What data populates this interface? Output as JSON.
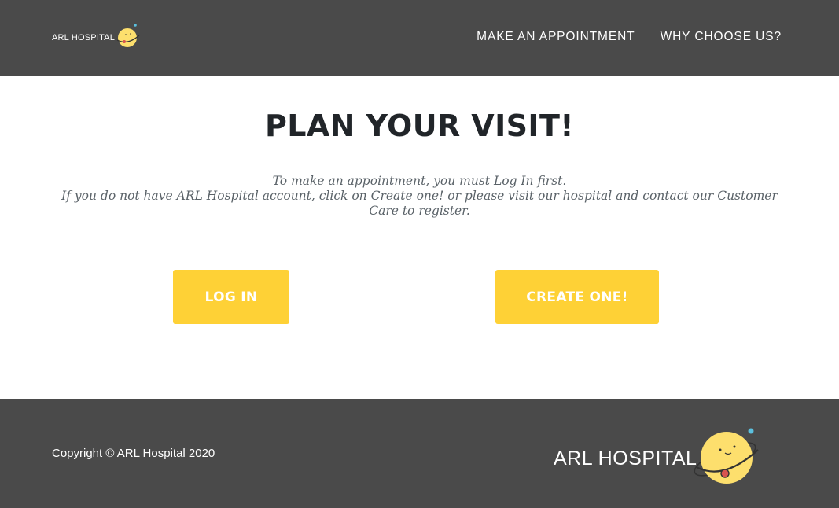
{
  "header": {
    "brand_text": "ARL HOSPITAL",
    "logo_icon": "planet-smiley-icon",
    "nav": [
      {
        "label": "MAKE AN APPOINTMENT"
      },
      {
        "label": "WHY CHOOSE US?"
      }
    ]
  },
  "main": {
    "title": "PLAN YOUR VISIT!",
    "intro_line1": "To make an appointment, you must Log In first.",
    "intro_line2": "If you do not have ARL Hospital account, click on Create one! or please visit our hospital and contact our Customer Care to register.",
    "login_label": "LOG IN",
    "create_label": "CREATE ONE!"
  },
  "footer": {
    "copyright": "Copyright © ARL Hospital 2020",
    "brand_text": "ARL HOSPITAL",
    "logo_icon": "planet-smiley-icon"
  },
  "colors": {
    "header_bg": "#4a4a4a",
    "accent": "#fed136",
    "heading": "#212529",
    "body_text": "#5a6268"
  }
}
